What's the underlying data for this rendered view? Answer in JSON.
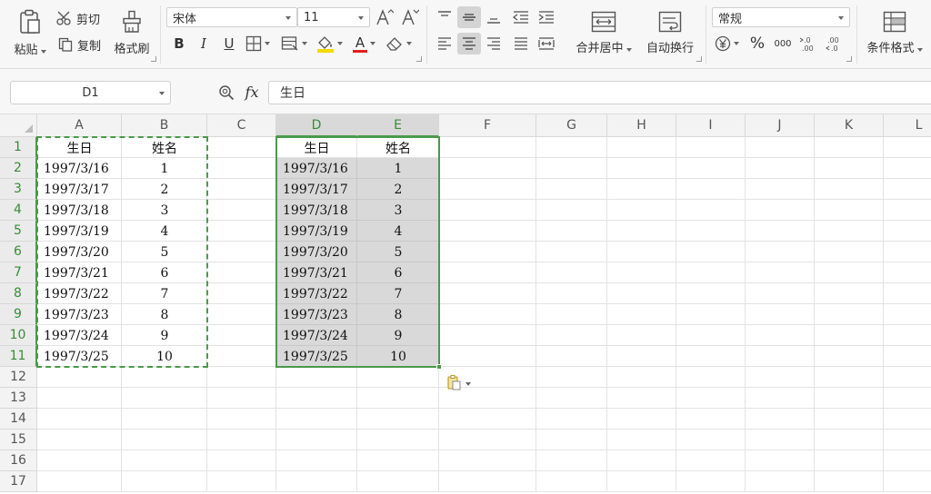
{
  "ribbon": {
    "paste_label": "粘贴",
    "cut_label": "剪切",
    "copy_label": "复制",
    "format_painter_label": "格式刷",
    "font_name": "宋体",
    "font_size": "11",
    "bold": "B",
    "italic": "I",
    "underline": "U",
    "font_color_letter": "A",
    "merge_center_label": "合并居中",
    "wrap_text_label": "自动换行",
    "number_format": "常规",
    "percent": "%",
    "thousands": "000",
    "increase_decimal": ".0→.00",
    "conditional_format_label": "条件格式"
  },
  "formula_bar": {
    "name_box": "D1",
    "fx_label": "fx",
    "content": "生日"
  },
  "columns": [
    "A",
    "B",
    "C",
    "D",
    "E",
    "F",
    "G",
    "H",
    "I",
    "J",
    "K",
    "L"
  ],
  "rows": [
    "1",
    "2",
    "3",
    "4",
    "5",
    "6",
    "7",
    "8",
    "9",
    "10",
    "11",
    "12",
    "13",
    "14",
    "15",
    "16",
    "17"
  ],
  "selected_columns": [
    "D",
    "E"
  ],
  "selected_rows": [
    "1",
    "2",
    "3",
    "4",
    "5",
    "6",
    "7",
    "8",
    "9",
    "10",
    "11"
  ],
  "source_table": {
    "headers": [
      "生日",
      "姓名"
    ],
    "rows": [
      [
        "1997/3/16",
        "1"
      ],
      [
        "1997/3/17",
        "2"
      ],
      [
        "1997/3/18",
        "3"
      ],
      [
        "1997/3/19",
        "4"
      ],
      [
        "1997/3/20",
        "5"
      ],
      [
        "1997/3/21",
        "6"
      ],
      [
        "1997/3/22",
        "7"
      ],
      [
        "1997/3/23",
        "8"
      ],
      [
        "1997/3/24",
        "9"
      ],
      [
        "1997/3/25",
        "10"
      ]
    ]
  },
  "pasted_table": {
    "headers": [
      "生日",
      "姓名"
    ],
    "rows": [
      [
        "1997/3/16",
        "1"
      ],
      [
        "1997/3/17",
        "2"
      ],
      [
        "1997/3/18",
        "3"
      ],
      [
        "1997/3/19",
        "4"
      ],
      [
        "1997/3/20",
        "5"
      ],
      [
        "1997/3/21",
        "6"
      ],
      [
        "1997/3/22",
        "7"
      ],
      [
        "1997/3/23",
        "8"
      ],
      [
        "1997/3/24",
        "9"
      ],
      [
        "1997/3/25",
        "10"
      ]
    ]
  },
  "colors": {
    "accent_green": "#4a9a4a",
    "selection_fill": "#d9d9d9",
    "font_color_bar": "#e02020",
    "fill_color_bar": "#f5d800"
  }
}
